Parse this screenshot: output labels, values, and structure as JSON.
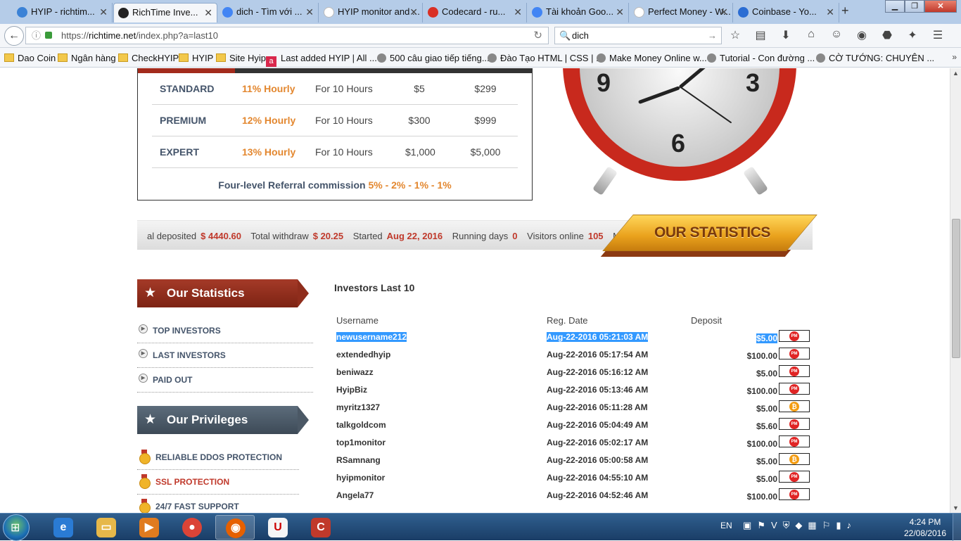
{
  "browser": {
    "tabs": [
      {
        "label": "HYIP - richtim...",
        "color": "#3b82d6",
        "icon": "globe"
      },
      {
        "label": "RichTime Inve...",
        "color": "#222222",
        "icon": "hourglass"
      },
      {
        "label": "dich - Tìm với ...",
        "color": "#4285f4",
        "icon": "google"
      },
      {
        "label": "HYIP monitor and ...",
        "color": "#ffffff",
        "icon": "blank"
      },
      {
        "label": "Codecard - ru...",
        "color": "#d93025",
        "icon": "gmail"
      },
      {
        "label": "Tài khoản Goo...",
        "color": "#4285f4",
        "icon": "google"
      },
      {
        "label": "Perfect Money - W...",
        "color": "#ffffff",
        "icon": "blank"
      },
      {
        "label": "Coinbase - Yo...",
        "color": "#2b6dd3",
        "icon": "coinbase"
      }
    ],
    "url_prefix": "https://",
    "url_host": "richtime.net",
    "url_path": "/index.php?a=last10",
    "search_value": "dich",
    "new_tab_glyph": "+",
    "tab_close_glyph": "✕"
  },
  "bookmarks": [
    {
      "label": "Dao Coin",
      "icon": "folder"
    },
    {
      "label": "Ngân hàng",
      "icon": "folder"
    },
    {
      "label": "CheckHYIP",
      "icon": "folder"
    },
    {
      "label": "HYIP",
      "icon": "folder"
    },
    {
      "label": "Site Hyip",
      "icon": "folder"
    },
    {
      "label": "Last added HYIP | All ...",
      "icon": "a"
    },
    {
      "label": "500 câu giao tiếp tiếng...",
      "icon": "globe"
    },
    {
      "label": "Đào Tạo HTML | CSS | ...",
      "icon": "globe"
    },
    {
      "label": "Make Money Online w...",
      "icon": "globe"
    },
    {
      "label": "Tutorial - Con đường ...",
      "icon": "globe"
    },
    {
      "label": "CỜ TƯỚNG: CHUYÊN ...",
      "icon": "globe"
    }
  ],
  "plans": [
    {
      "name": "STANDARD",
      "rate": "11% Hourly",
      "duration": "For 10 Hours",
      "min": "$5",
      "max": "$299"
    },
    {
      "name": "PREMIUM",
      "rate": "12% Hourly",
      "duration": "For 10 Hours",
      "min": "$300",
      "max": "$999"
    },
    {
      "name": "EXPERT",
      "rate": "13% Hourly",
      "duration": "For 10 Hours",
      "min": "$1,000",
      "max": "$5,000"
    }
  ],
  "referral": {
    "label": "Four-level Referral commission",
    "levels": "5% - 2% - 1% - 1%"
  },
  "clock": {
    "numerals": [
      "9",
      "3",
      "6"
    ]
  },
  "stats_ticker": {
    "deposited_label": "al deposited",
    "deposited_value": "$ 4440.60",
    "withdraw_label": "Total withdraw",
    "withdraw_value": "$ 20.25",
    "started_label": "Started",
    "started_value": "Aug 22, 2016",
    "running_label": "Running days",
    "running_value": "0",
    "visitors_label": "Visitors online",
    "visitors_value": "105",
    "members_label": "Memb"
  },
  "our_statistics_banner": "OUR STATISTICS",
  "sidebar": {
    "stats_heading": "Our Statistics",
    "stats_links": [
      "TOP INVESTORS",
      "LAST INVESTORS",
      "PAID OUT"
    ],
    "privileges_heading": "Our Privileges",
    "privileges": [
      "RELIABLE DDOS PROTECTION",
      "SSL PROTECTION",
      "24/7 FAST SUPPORT"
    ]
  },
  "investors": {
    "title": "Investors Last 10",
    "columns": [
      "Username",
      "Reg. Date",
      "Deposit"
    ],
    "rows": [
      {
        "username": "newusername212",
        "date": "Aug-22-2016 05:21:03 AM",
        "amount": "$5.00",
        "method": "PM",
        "selected": true
      },
      {
        "username": "extendedhyip",
        "date": "Aug-22-2016 05:17:54 AM",
        "amount": "$100.00",
        "method": "PM"
      },
      {
        "username": "beniwazz",
        "date": "Aug-22-2016 05:16:12 AM",
        "amount": "$5.00",
        "method": "PM"
      },
      {
        "username": "HyipBiz",
        "date": "Aug-22-2016 05:13:46 AM",
        "amount": "$100.00",
        "method": "PM"
      },
      {
        "username": "myritz1327",
        "date": "Aug-22-2016 05:11:28 AM",
        "amount": "$5.00",
        "method": "BTC"
      },
      {
        "username": "talkgoldcom",
        "date": "Aug-22-2016 05:04:49 AM",
        "amount": "$5.60",
        "method": "PM"
      },
      {
        "username": "top1monitor",
        "date": "Aug-22-2016 05:02:17 AM",
        "amount": "$100.00",
        "method": "PM"
      },
      {
        "username": "RSamnang",
        "date": "Aug-22-2016 05:00:58 AM",
        "amount": "$5.00",
        "method": "BTC"
      },
      {
        "username": "hyipmonitor",
        "date": "Aug-22-2016 04:55:10 AM",
        "amount": "$5.00",
        "method": "PM"
      },
      {
        "username": "Angela77",
        "date": "Aug-22-2016 04:52:46 AM",
        "amount": "$100.00",
        "method": "PM"
      }
    ]
  },
  "taskbar": {
    "language": "EN",
    "time": "4:24 PM",
    "date": "22/08/2016"
  },
  "colors": {
    "accent_orange": "#e3872f",
    "stat_red": "#c0392b",
    "selection": "#3399ff"
  }
}
